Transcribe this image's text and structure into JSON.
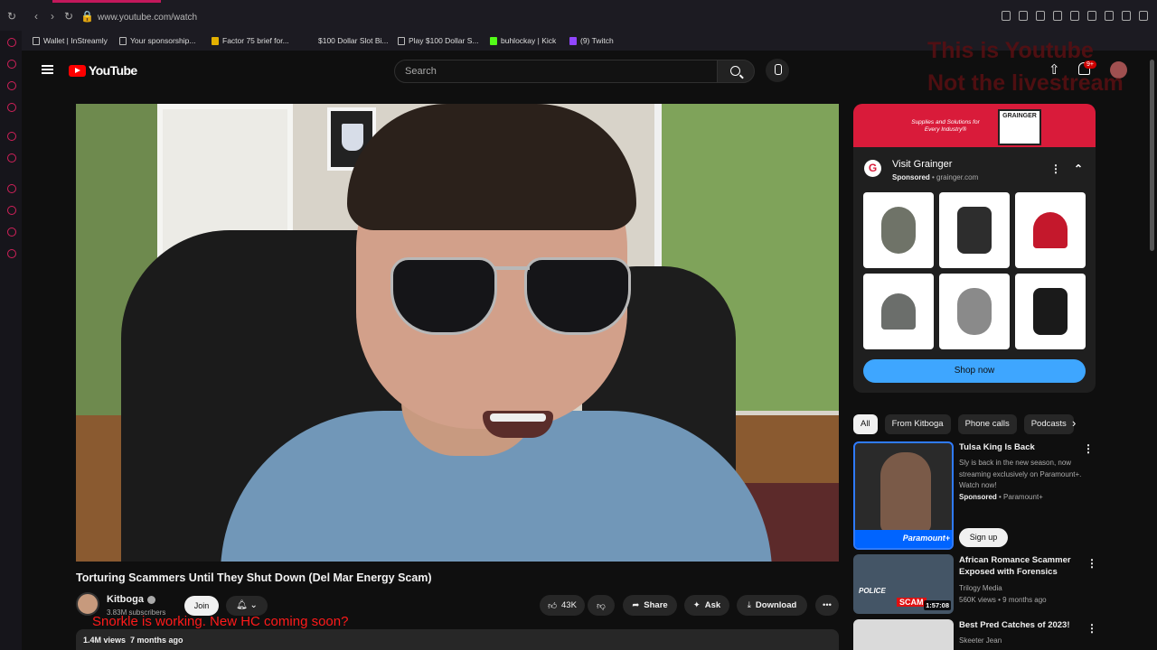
{
  "browser": {
    "url": "www.youtube.com/watch",
    "bookmarks": [
      {
        "label": "Wallet | InStreamly"
      },
      {
        "label": "Your sponsorship..."
      },
      {
        "label": "Factor 75 brief for..."
      },
      {
        "label": "$100 Dollar Slot Bi..."
      },
      {
        "label": "Play $100 Dollar S..."
      },
      {
        "label": "buhlockay | Kick"
      },
      {
        "label": "(9) Twitch"
      }
    ]
  },
  "header": {
    "logo_text": "YouTube",
    "search_placeholder": "Search",
    "notification_badge": "9+"
  },
  "overlay": {
    "line1": "This is Youtube",
    "line2": "Not the livestream",
    "snorkle_text": "Snorkle is working. New HC coming soon?"
  },
  "video": {
    "title": "Torturing Scammers Until They Shut Down (Del Mar Energy Scam)",
    "channel": "Kitboga",
    "subscribers": "3.83M subscribers",
    "join_label": "Join",
    "likes": "43K",
    "share_label": "Share",
    "ask_label": "Ask",
    "download_label": "Download",
    "views": "1.4M views",
    "age": "7 months ago"
  },
  "ad": {
    "banner_tagline": "Supplies and Solutions for Every Industry®",
    "banner_brand": "GRAINGER",
    "title": "Visit Grainger",
    "sponsored": "Sponsored",
    "domain": "grainger.com",
    "cta": "Shop now",
    "brand_color": "#d91b3a",
    "cta_color": "#3ea6ff"
  },
  "chips": [
    {
      "label": "All",
      "active": true
    },
    {
      "label": "From Kitboga"
    },
    {
      "label": "Phone calls"
    },
    {
      "label": "Podcasts"
    }
  ],
  "recommendations": [
    {
      "title": "Tulsa King Is Back",
      "description": "Sly is back in the new season, now streaming exclusively on Paramount+. Watch now!",
      "sponsored": "Sponsored",
      "sponsor": "Paramount+",
      "cta": "Sign up",
      "thumb_text": "Paramount+"
    },
    {
      "title": "African Romance Scammer Exposed with Forensics",
      "channel": "Trilogy Media",
      "stats": "560K views • 9 months ago",
      "duration": "1:57:08",
      "thumb_text1": "POLICE",
      "thumb_text2": "SCAM"
    },
    {
      "title": "Best Pred Catches of 2023!",
      "channel": "Skeeter Jean"
    }
  ]
}
